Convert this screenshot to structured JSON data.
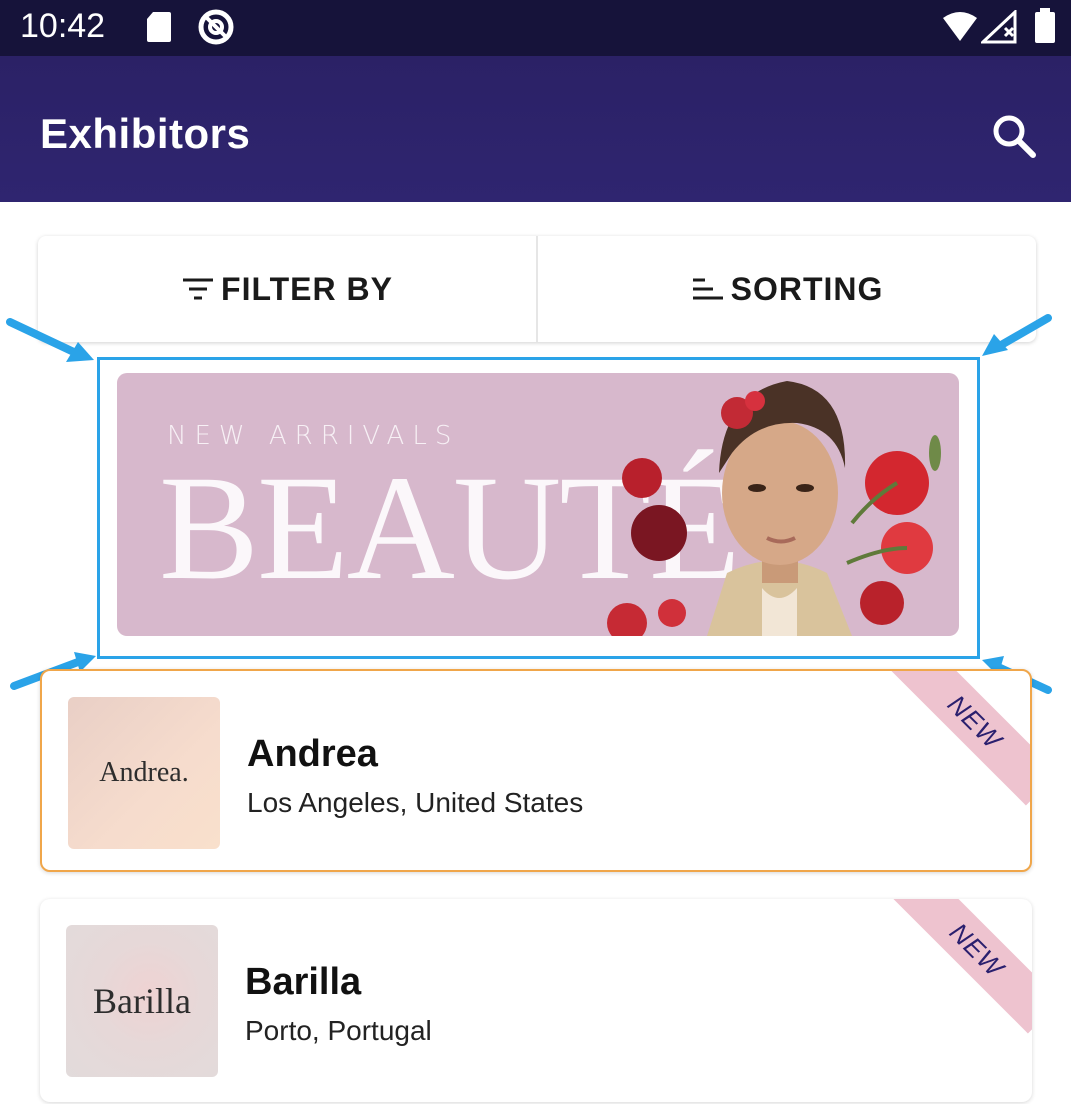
{
  "status_bar": {
    "time": "10:42",
    "icons": [
      "sd-card-icon",
      "do-not-disturb-icon",
      "wifi-icon",
      "signal-icon",
      "battery-icon"
    ]
  },
  "app_bar": {
    "title": "Exhibitors",
    "search_icon": "search-icon"
  },
  "controls": {
    "filter_label": "FILTER BY",
    "filter_icon": "filter-icon",
    "sort_label": "SORTING",
    "sort_icon": "sort-icon"
  },
  "banner": {
    "subtitle": "NEW ARRIVALS",
    "title": "BEAUTÉ",
    "highlight_color": "#2aa3e8"
  },
  "exhibitors": [
    {
      "logo_text": "Andrea.",
      "name": "Andrea",
      "location": "Los Angeles, United States",
      "badge": "NEW"
    },
    {
      "logo_text": "Barilla",
      "name": "Barilla",
      "location": "Porto, Portugal",
      "badge": "NEW"
    }
  ],
  "colors": {
    "app_bar": "#2b2166",
    "status_bar": "#16133a",
    "badge_bg": "#eec3cf",
    "badge_text": "#2a1f6e",
    "selected_card_border": "#f0a64a"
  }
}
